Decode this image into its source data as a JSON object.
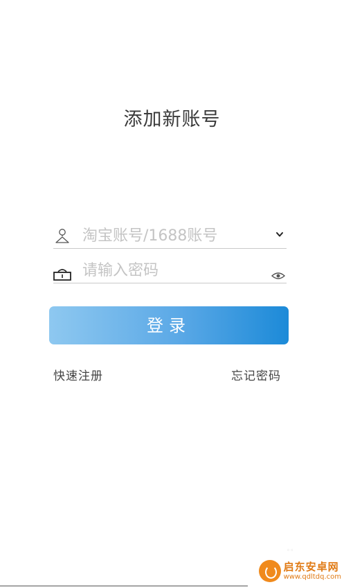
{
  "page": {
    "title": "添加新账号"
  },
  "account_field": {
    "placeholder": "淘宝账号/1688账号",
    "value": "",
    "icon": "user-icon",
    "dropdown_icon": "chevron-down-icon"
  },
  "password_field": {
    "placeholder": "请输入密码",
    "value": "",
    "icon": "lock-icon",
    "visibility_icon": "eye-icon"
  },
  "login_button": {
    "label": "登录",
    "gradient_start": "#8ec8f0",
    "gradient_end": "#1c8ad8"
  },
  "links": {
    "register": "快速注册",
    "forgot_password": "忘记密码"
  },
  "watermark": {
    "name": "启东安卓网",
    "url": "www.qdltdq.com",
    "color": "#e07a14"
  }
}
